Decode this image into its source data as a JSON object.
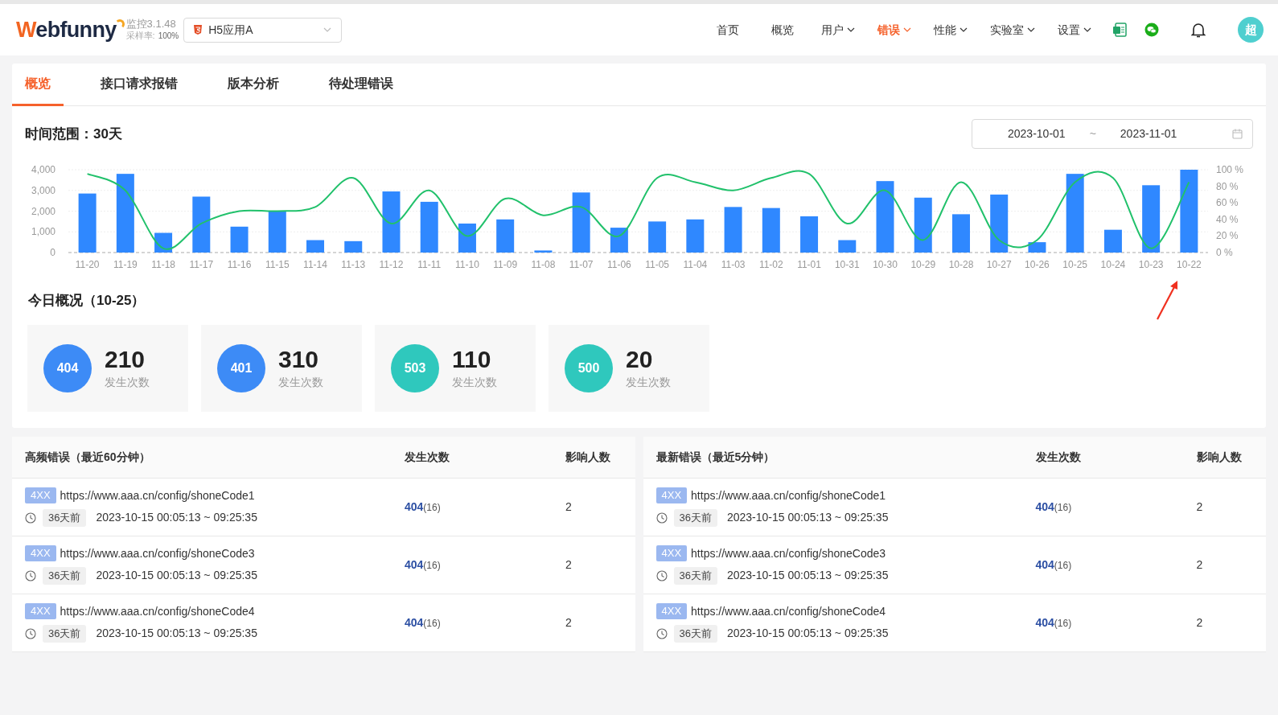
{
  "header": {
    "logo": "Webfunny",
    "version": "监控3.1.48",
    "sample_label": "采样率:",
    "sample_value": "100%",
    "app_select": {
      "value": "H5应用A"
    },
    "nav": [
      {
        "label": "首页",
        "dropdown": false,
        "selected": false
      },
      {
        "label": "概览",
        "dropdown": false,
        "selected": false
      },
      {
        "label": "用户",
        "dropdown": true,
        "selected": false
      },
      {
        "label": "错误",
        "dropdown": true,
        "selected": true
      },
      {
        "label": "性能",
        "dropdown": true,
        "selected": false
      },
      {
        "label": "实验室",
        "dropdown": true,
        "selected": false
      },
      {
        "label": "设置",
        "dropdown": true,
        "selected": false
      }
    ],
    "avatar": "超"
  },
  "tabs": [
    {
      "label": "概览",
      "selected": true
    },
    {
      "label": "接口请求报错",
      "selected": false
    },
    {
      "label": "版本分析",
      "selected": false
    },
    {
      "label": "待处理错误",
      "selected": false
    }
  ],
  "time_range": "时间范围：30天",
  "date_range": {
    "start": "2023-10-01",
    "separator": "~",
    "end": "2023-11-01"
  },
  "chart_data": {
    "type": "bar",
    "categories": [
      "11-20",
      "11-19",
      "11-18",
      "11-17",
      "11-16",
      "11-15",
      "11-14",
      "11-13",
      "11-12",
      "11-11",
      "11-10",
      "11-09",
      "11-08",
      "11-07",
      "11-06",
      "11-05",
      "11-04",
      "11-03",
      "11-02",
      "11-01",
      "10-31",
      "10-30",
      "10-29",
      "10-28",
      "10-27",
      "10-26",
      "10-25",
      "10-24",
      "10-23",
      "10-22"
    ],
    "series": [
      {
        "color": "#2f88ff",
        "values": [
          2850,
          3800,
          950,
          2700,
          1250,
          2000,
          600,
          550,
          2950,
          2450,
          1400,
          1600,
          100,
          2900,
          1200,
          1500,
          1600,
          2200,
          2150,
          1750,
          600,
          3450,
          2650,
          1850,
          2800,
          500,
          3800,
          1100,
          3250,
          4000
        ]
      },
      {
        "type": "line",
        "axis": "y2",
        "color": "#21c16b",
        "values": [
          95,
          75,
          5,
          35,
          50,
          50,
          55,
          90,
          35,
          75,
          20,
          65,
          45,
          55,
          20,
          90,
          85,
          75,
          90,
          95,
          35,
          75,
          15,
          85,
          15,
          15,
          85,
          90,
          5,
          85
        ]
      }
    ],
    "ylim": [
      0,
      4000
    ],
    "yticks": [
      {
        "value": 0,
        "label": "0"
      },
      {
        "value": 1000,
        "label": "1,000"
      },
      {
        "value": 2000,
        "label": "2,000"
      },
      {
        "value": 3000,
        "label": "3,000"
      },
      {
        "value": 4000,
        "label": "4,000"
      }
    ],
    "y2lim": [
      0,
      100
    ],
    "grid": true,
    "y2ticks": [
      {
        "value": 0,
        "label": "0 %"
      },
      {
        "value": 20,
        "label": "20 %"
      },
      {
        "value": 40,
        "label": "40 %"
      },
      {
        "value": 60,
        "label": "60 %"
      },
      {
        "value": 80,
        "label": "80 %"
      },
      {
        "value": 100,
        "label": "100 %"
      }
    ]
  },
  "today": {
    "title": "今日概况（10-25）",
    "stats": [
      {
        "code": "404",
        "count": "210",
        "label": "发生次数",
        "color": "#3d8bf6"
      },
      {
        "code": "401",
        "count": "310",
        "label": "发生次数",
        "color": "#3d8bf6"
      },
      {
        "code": "503",
        "count": "110",
        "label": "发生次数",
        "color": "#2fc8bd"
      },
      {
        "code": "500",
        "count": "20",
        "label": "发生次数",
        "color": "#2fc8bd"
      }
    ]
  },
  "tables": [
    {
      "columns": [
        "高频错误（最近60分钟）",
        "发生次数",
        "影响人数"
      ],
      "rows": [
        {
          "tag": "4XX",
          "url": "https://www.aaa.cn/config/shoneCode1",
          "age": "36天前",
          "time": "2023-10-15 00:05:13 ~ 09:25:35",
          "code": "404",
          "count": "(16)",
          "users": "2"
        },
        {
          "tag": "4XX",
          "url": "https://www.aaa.cn/config/shoneCode3",
          "age": "36天前",
          "time": "2023-10-15 00:05:13 ~ 09:25:35",
          "code": "404",
          "count": "(16)",
          "users": "2"
        },
        {
          "tag": "4XX",
          "url": "https://www.aaa.cn/config/shoneCode4",
          "age": "36天前",
          "time": "2023-10-15 00:05:13 ~ 09:25:35",
          "code": "404",
          "count": "(16)",
          "users": "2"
        }
      ]
    },
    {
      "columns": [
        "最新错误（最近5分钟）",
        "发生次数",
        "影响人数"
      ],
      "rows": [
        {
          "tag": "4XX",
          "url": "https://www.aaa.cn/config/shoneCode1",
          "age": "36天前",
          "time": "2023-10-15 00:05:13 ~ 09:25:35",
          "code": "404",
          "count": "(16)",
          "users": "2"
        },
        {
          "tag": "4XX",
          "url": "https://www.aaa.cn/config/shoneCode3",
          "age": "36天前",
          "time": "2023-10-15 00:05:13 ~ 09:25:35",
          "code": "404",
          "count": "(16)",
          "users": "2"
        },
        {
          "tag": "4XX",
          "url": "https://www.aaa.cn/config/shoneCode4",
          "age": "36天前",
          "time": "2023-10-15 00:05:13 ~ 09:25:35",
          "code": "404",
          "count": "(16)",
          "users": "2"
        }
      ]
    }
  ]
}
